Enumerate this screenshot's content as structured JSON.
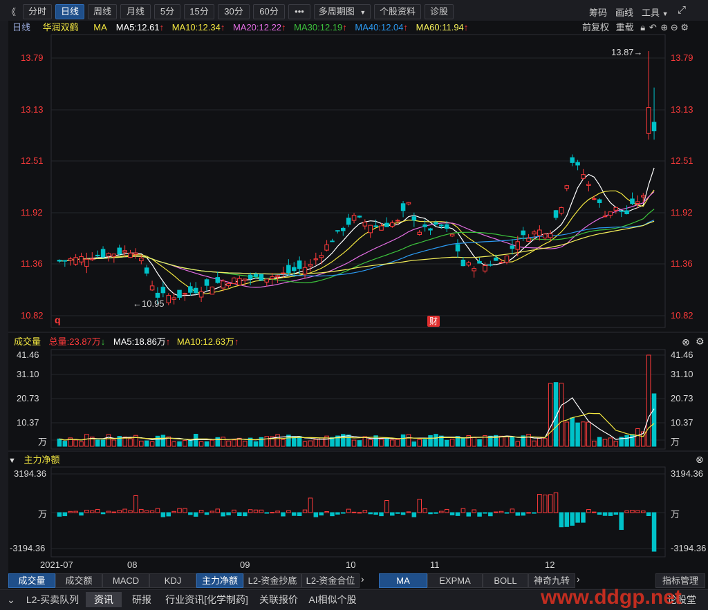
{
  "toolbar": {
    "back": "《",
    "periods": [
      "分时",
      "日线",
      "周线",
      "月线",
      "5分",
      "15分",
      "30分",
      "60分"
    ],
    "active_period": "日线",
    "more": "•••",
    "multi_period": "多周期图",
    "stock_info": "个股资料",
    "diagnose": "诊股",
    "right": {
      "chips": "筹码",
      "draw": "画线",
      "tools": "工具"
    }
  },
  "ma_bar": {
    "period": "日线",
    "stock": "华润双鹤",
    "ma_label": "MA",
    "ma5": "MA5:12.61",
    "ma10": "MA10:12.34",
    "ma20": "MA20:12.22",
    "ma30": "MA30:12.19",
    "ma40": "MA40:12.04",
    "ma60": "MA60:11.94",
    "adjust": "前复权",
    "redraw": "重载"
  },
  "price_axis": {
    "labels": [
      "13.79",
      "13.13",
      "12.51",
      "11.92",
      "11.36",
      "10.82"
    ]
  },
  "price_annotations": {
    "high": "13.87→",
    "low": "←10.95",
    "q_mark": "q",
    "cai_mark": "财"
  },
  "volume_panel": {
    "title": "成交量",
    "total": "总量:23.87万",
    "ma5": "MA5:18.86万",
    "ma10": "MA10:12.63万",
    "axis": [
      "41.46",
      "31.10",
      "20.73",
      "10.37",
      "万"
    ]
  },
  "flow_panel": {
    "title": "主力净额",
    "axis": [
      "3194.36",
      "万",
      "-3194.36"
    ]
  },
  "date_axis": [
    "2021-07",
    "08",
    "09",
    "10",
    "11",
    "12"
  ],
  "indicator_tabs": {
    "left": [
      "成交量",
      "成交额",
      "MACD",
      "KDJ",
      "主力净额",
      "L2-资金抄底",
      "L2-资金合位"
    ],
    "active_left": [
      "成交量",
      "主力净额"
    ],
    "right": [
      "MA",
      "EXPMA",
      "BOLL",
      "神奇九转"
    ],
    "active_right": "MA",
    "manage": "指标管理"
  },
  "bottom_tabs": {
    "items": [
      "L2-买卖队列",
      "资讯",
      "研报",
      "行业资讯[化学制药]",
      "关联报价",
      "AI相似个股"
    ],
    "active": "资讯",
    "right": "论股堂",
    "watermark": "www.ddgp.net"
  },
  "colors": {
    "up": "#ff3b3b",
    "down": "#00c2c9",
    "ma5": "#ffffff",
    "ma10": "#f2e640",
    "ma20": "#e46ee4",
    "ma30": "#3cc23c",
    "ma40": "#2b9bf4",
    "ma60": "#f5f05a"
  },
  "chart_data": {
    "type": "candlestick",
    "title": "华润双鹤 日线",
    "ylim": [
      10.82,
      13.87
    ],
    "annotated_high": 13.87,
    "annotated_low": 10.95,
    "ma_last": {
      "MA5": 12.61,
      "MA10": 12.34,
      "MA20": 12.22,
      "MA30": 12.19,
      "MA40": 12.04,
      "MA60": 11.94
    },
    "volume_unit": "万",
    "volume_ylim": [
      0,
      41.46
    ],
    "volume_ma_last": {
      "MA5": 18.86,
      "MA10": 12.63
    },
    "volume_total_last": 23.87,
    "flow_ylim": [
      -3194.36,
      3194.36
    ]
  }
}
